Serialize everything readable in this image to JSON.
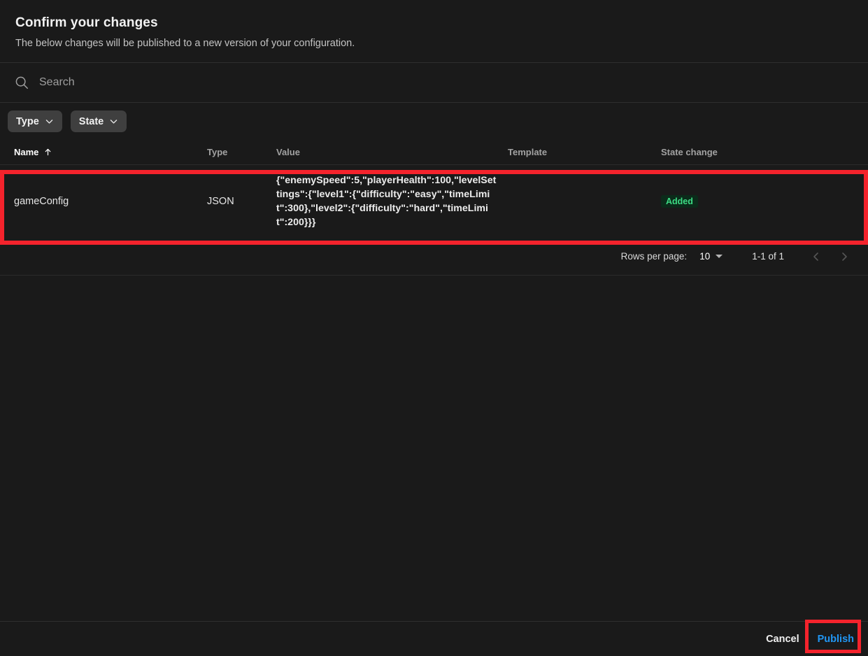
{
  "dialog": {
    "title": "Confirm your changes",
    "subtitle": "The below changes will be published to a new version of your configuration."
  },
  "search": {
    "placeholder": "Search",
    "value": "",
    "icon": "search-icon"
  },
  "filters": [
    {
      "label": "Type",
      "icon": "chevron-down-icon"
    },
    {
      "label": "State",
      "icon": "chevron-down-icon"
    }
  ],
  "table": {
    "columns": [
      {
        "key": "name",
        "label": "Name",
        "sorted": true,
        "sort_icon": "arrow-up-icon"
      },
      {
        "key": "type",
        "label": "Type",
        "sorted": false
      },
      {
        "key": "value",
        "label": "Value",
        "sorted": false
      },
      {
        "key": "template",
        "label": "Template",
        "sorted": false
      },
      {
        "key": "state_change",
        "label": "State change",
        "sorted": false
      }
    ],
    "rows": [
      {
        "name": "gameConfig",
        "type": "JSON",
        "value": "{\"enemySpeed\":5,\"playerHealth\":100,\"levelSettings\":{\"level1\":{\"difficulty\":\"easy\",\"timeLimit\":300},\"level2\":{\"difficulty\":\"hard\",\"timeLimit\":200}}}",
        "template": "",
        "state_change": "Added"
      }
    ]
  },
  "pagination": {
    "rows_per_page_label": "Rows per page:",
    "rows_per_page_value": "10",
    "range_label": "1-1 of 1",
    "prev_icon": "chevron-left-icon",
    "next_icon": "chevron-right-icon"
  },
  "footer": {
    "cancel_label": "Cancel",
    "publish_label": "Publish"
  },
  "colors": {
    "background": "#1a1a1a",
    "annotation_red": "#f4232c",
    "publish_blue": "#2196f3",
    "added_badge_text": "#3ddc84",
    "added_badge_bg": "#0b2b1a",
    "chip_bg": "#3f3f3f"
  }
}
